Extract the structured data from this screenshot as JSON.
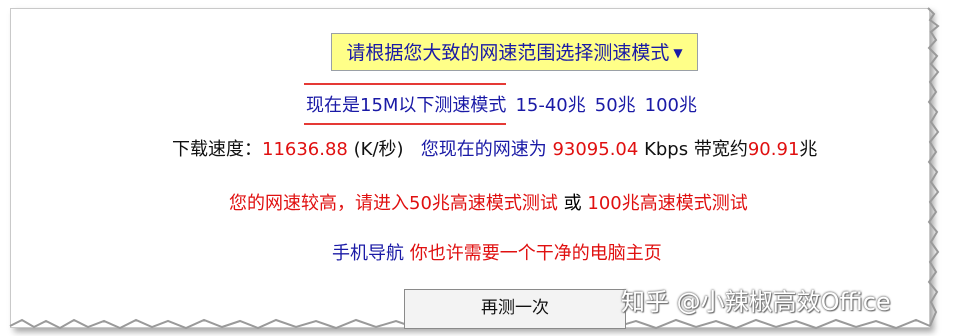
{
  "mode_select": {
    "label": "请根据您大致的网速范围选择测速模式",
    "chevron": "chevron-down-icon"
  },
  "mode_row": {
    "current": "现在是15M以下测速模式",
    "options": [
      "15-40兆",
      "50兆",
      "100兆"
    ]
  },
  "speed_row": {
    "download_label": "下载速度：",
    "download_value": "11636.88",
    "download_unit": "(K/秒)",
    "speed_text": "您现在的网速为",
    "kbps_value": "93095.04",
    "kbps_unit": "Kbps",
    "bandwidth_label": "带宽约",
    "bandwidth_value": "90.91",
    "bandwidth_unit": "兆"
  },
  "advice": {
    "part1": "您的网速较高，请进入50兆高速模式测试",
    "or": "或",
    "part2": "100兆高速模式测试"
  },
  "nav": {
    "phone_nav": "手机导航",
    "clean_home": "你也许需要一个干净的电脑主页"
  },
  "retest_button": "再测一次",
  "watermark": "知乎 @小辣椒高效Office",
  "colors": {
    "highlight_bg": "#ffff88",
    "link_blue": "#1a1aa6",
    "alert_red": "#e01010"
  }
}
